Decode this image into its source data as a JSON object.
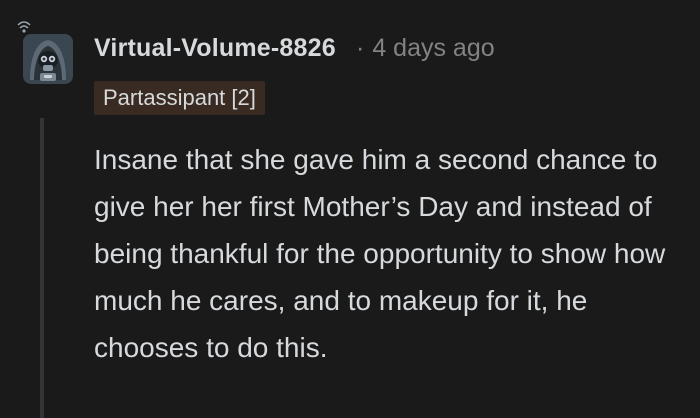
{
  "comment": {
    "author": "Virtual-Volume-8826",
    "separator": "·",
    "timestamp": "4 days ago",
    "flair": "Partassipant [2]",
    "body": "Insane that she gave him a second chance to give her her first Mother’s Day and instead of being thankful for the opportunity to show how much he cares, and to makeup for it, he chooses to do this.",
    "avatar_icon": "snoo-avatar-icon"
  },
  "colors": {
    "background": "#1a1a1b",
    "text": "#d7dadc",
    "meta": "#818384",
    "flair_bg": "#3a2b22",
    "thread_line": "#343536"
  }
}
